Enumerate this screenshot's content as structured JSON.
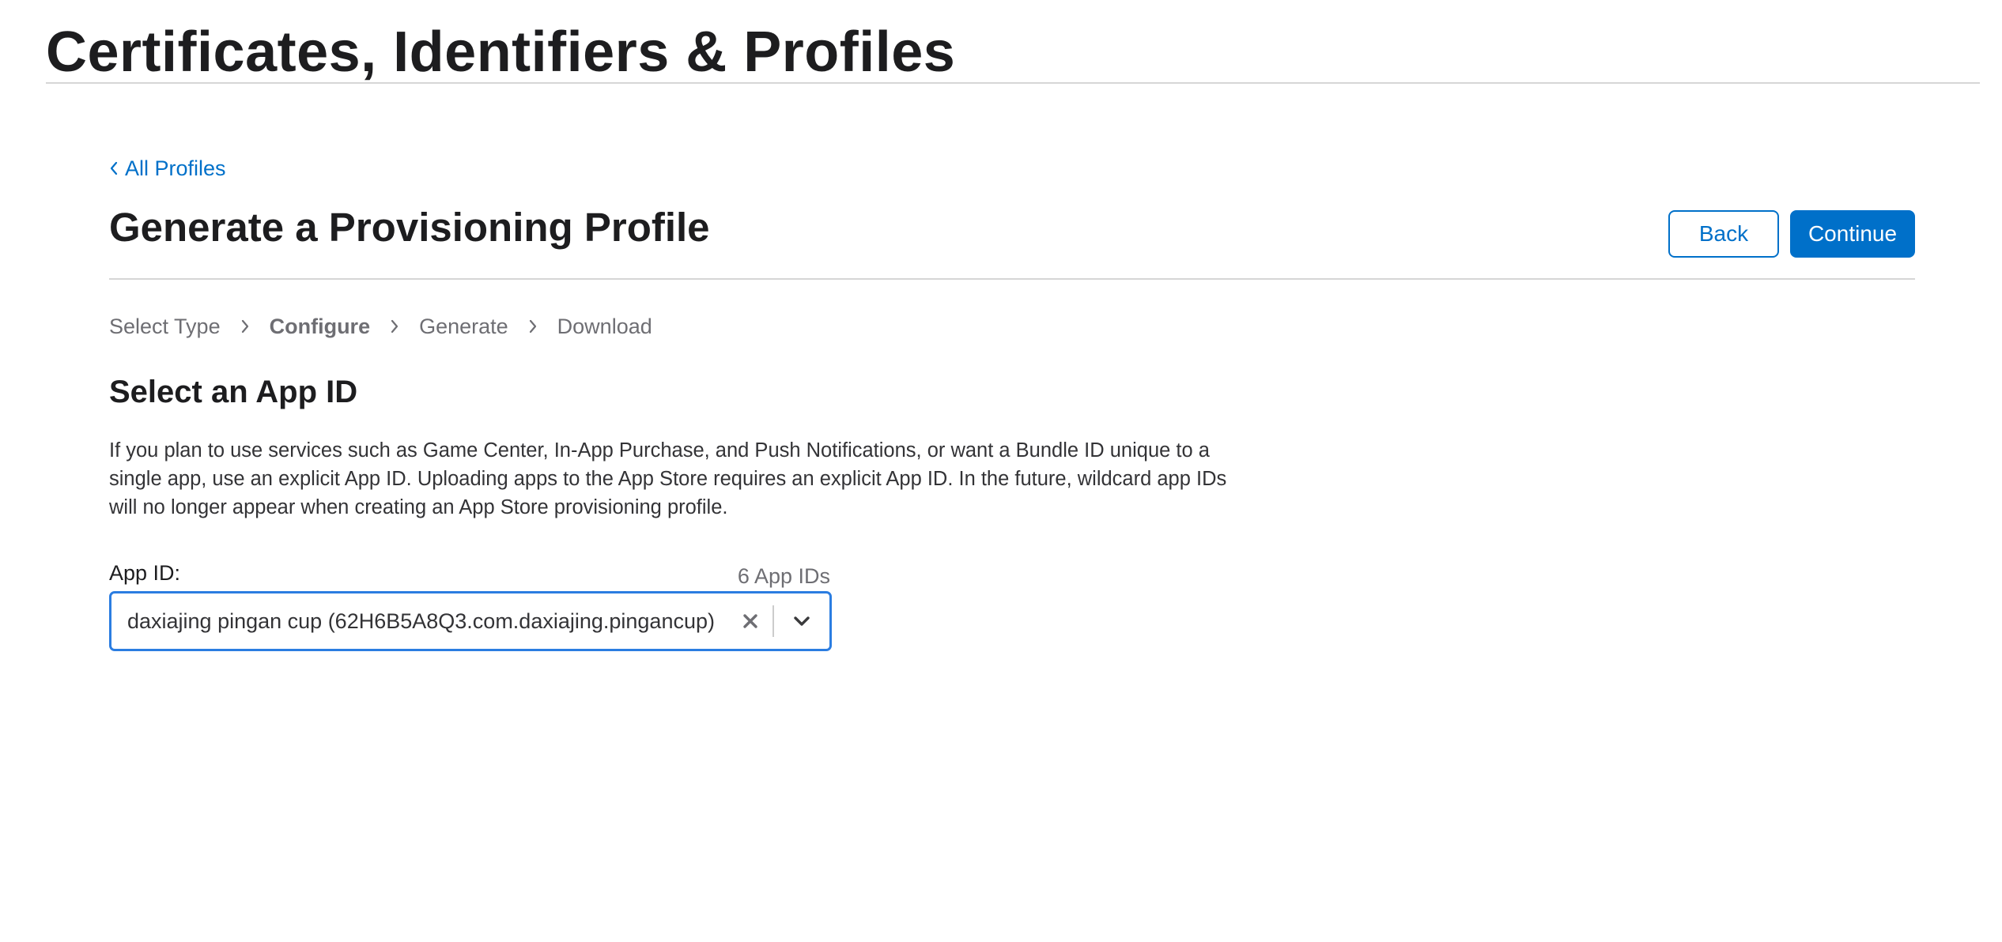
{
  "site": {
    "title": "Certificates, Identifiers & Profiles"
  },
  "breadcrumb": {
    "back_label": "All Profiles",
    "back_icon": "chevron-left-icon"
  },
  "header": {
    "title": "Generate a Provisioning Profile",
    "back_button": "Back",
    "continue_button": "Continue"
  },
  "steps": [
    {
      "label": "Select Type",
      "active": false
    },
    {
      "label": "Configure",
      "active": true
    },
    {
      "label": "Generate",
      "active": false
    },
    {
      "label": "Download",
      "active": false
    }
  ],
  "section": {
    "title": "Select an App ID",
    "description": "If you plan to use services such as Game Center, In-App Purchase, and Push Notifications, or want a Bundle ID unique to a single app, use an explicit App ID. Uploading apps to the App Store requires an explicit App ID. In the future, wildcard app IDs will no longer appear when creating an App Store provisioning profile."
  },
  "app_id_field": {
    "label": "App ID:",
    "count": "6 App IDs",
    "selected_value": "daxiajing pingan cup (62H6B5A8Q3.com.daxiajing.pingancup)",
    "clear_icon": "close-icon",
    "dropdown_icon": "chevron-down-icon"
  },
  "colors": {
    "accent": "#0070c9",
    "focus_border": "#2b7de1",
    "text": "#1d1d1f",
    "secondary_text": "#6e6e73",
    "rule": "#d6d6d6"
  }
}
